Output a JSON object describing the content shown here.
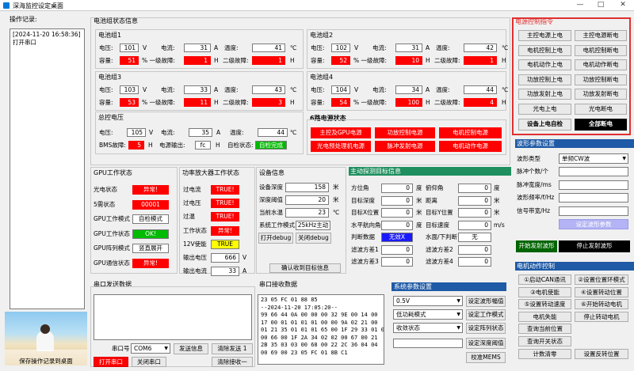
{
  "window": {
    "title": "深海监控设定桌面",
    "min": "—",
    "max": "□",
    "close": "✕"
  },
  "log": {
    "title": "操作记录:",
    "lines": "[2024-11-20 16:58:36]\n打开串口",
    "save": "保存操作记录到桌面"
  },
  "battery": {
    "title": "电池组状态信息",
    "groups": [
      {
        "name": "电池组1",
        "v": "101",
        "i": "31",
        "t": "41",
        "cap": "51",
        "f1": "1",
        "f2": "1"
      },
      {
        "name": "电池组2",
        "v": "102",
        "i": "31",
        "t": "42",
        "cap": "52",
        "f1": "10",
        "f2": "1"
      },
      {
        "name": "电池组3",
        "v": "103",
        "i": "33",
        "t": "43",
        "cap": "53",
        "f1": "11",
        "f2": "3"
      },
      {
        "name": "电池组4",
        "v": "104",
        "i": "34",
        "t": "44",
        "cap": "54",
        "f1": "100",
        "f2": "4"
      }
    ],
    "lbl": {
      "v": "电压:",
      "i": "电流:",
      "t": "温度:",
      "cap": "容量:",
      "f1": "%  一级故障:",
      "f2": "二级故障:",
      "uv": "V",
      "ui": "A",
      "ut": "℃",
      "uf": "H"
    },
    "total": {
      "name": "总控电压",
      "v": "105",
      "i": "35",
      "t": "44",
      "bms_label": "BMS故障:",
      "bms": "5",
      "bms_unit": "H",
      "out_label": "电源输出:",
      "out": "fc",
      "out_unit": "H",
      "self_label": "自检状态:",
      "self": "自检完成"
    }
  },
  "power6": {
    "title": "6路电源状态",
    "items": [
      "主控及GPU电源",
      "功放控制电源",
      "电机控制电源",
      "光电预处理机电源",
      "脉冲发射电源",
      "电机动作电源"
    ]
  },
  "ctrl": {
    "title": "电源控制指令",
    "buttons": [
      "主控电源上电",
      "主控电源断电",
      "电机控制上电",
      "电机控制断电",
      "电机动作上电",
      "电机动作断电",
      "功放控制上电",
      "功放控制断电",
      "功放发射上电",
      "功放发射断电",
      "光电上电",
      "光电断电"
    ],
    "selfcheck": "设备上电自检",
    "alloff": "全部断电"
  },
  "wave": {
    "title": "波形参数设置",
    "type_label": "波形类型",
    "type": "单频CW波",
    "fields": [
      "脉冲个数/个",
      "脉冲宽度/ms",
      "波形频率/f/Hz",
      "信号带宽/Hz"
    ],
    "set": "设定波形参数",
    "start": "开始发射波形",
    "stop": "停止发射波形"
  },
  "gpu": {
    "title": "GPU工作状态",
    "rows": [
      {
        "l": "光电状态",
        "v": "异常!"
      },
      {
        "l": "5需状态",
        "v": "00001"
      },
      {
        "l": "GPU工作模式",
        "v": "自检模式"
      },
      {
        "l": "GPU工作状态",
        "v": "OK!"
      },
      {
        "l": "GPU阵列模式",
        "v": "竖直展开"
      },
      {
        "l": "GPU通信状态",
        "v": "异常!"
      }
    ]
  },
  "amp": {
    "title": "功率放大器工作状态",
    "rows": [
      {
        "l": "过电流",
        "v": "TRUE!"
      },
      {
        "l": "过电压",
        "v": "TRUE!"
      },
      {
        "l": "过温",
        "v": "TRUE!"
      },
      {
        "l": "工作状态",
        "v": "异常!"
      },
      {
        "l": "12V使能",
        "v": "TRUE"
      },
      {
        "l": "输出电压",
        "v": "666",
        "u": "V"
      },
      {
        "l": "输出电流",
        "v": "33",
        "u": "A"
      }
    ]
  },
  "dev": {
    "title": "设备信息",
    "rows": [
      {
        "l": "设备深度",
        "v": "158",
        "u": "米"
      },
      {
        "l": "深度阈值",
        "v": "20",
        "u": "米"
      },
      {
        "l": "当前水温",
        "v": "23",
        "u": "℃"
      },
      {
        "l": "系统工作模式",
        "v": "25kHz主动",
        "u": ""
      }
    ],
    "dbg_on": "打开debug",
    "dbg_off": "关闭debug"
  },
  "sonar": {
    "title": "主动探测目标信息",
    "left": [
      {
        "l": "方位角",
        "v": "0",
        "u": "度"
      },
      {
        "l": "目标深度",
        "v": "0",
        "u": "米"
      },
      {
        "l": "目标X位置",
        "v": "0",
        "u": "米"
      },
      {
        "l": "水平航向角",
        "v": "0",
        "u": "度"
      },
      {
        "l": "判断数据",
        "v": "无效X",
        "u": ""
      },
      {
        "l": "滤波方差1",
        "v": "0",
        "u": ""
      },
      {
        "l": "滤波方差3",
        "v": "0",
        "u": ""
      }
    ],
    "right": [
      {
        "l": "俯仰角",
        "v": "0",
        "u": "度"
      },
      {
        "l": "距离",
        "v": "0",
        "u": "米"
      },
      {
        "l": "目标Y位置",
        "v": "0",
        "u": "米"
      },
      {
        "l": "目标速度",
        "v": "0",
        "u": "m/s"
      },
      {
        "l": "水面/下判断",
        "v": "无",
        "u": ""
      },
      {
        "l": "滤波方差2",
        "v": "0",
        "u": ""
      },
      {
        "l": "滤波方差4",
        "v": "0",
        "u": ""
      }
    ],
    "confirm": "确认收到目标信息"
  },
  "serial": {
    "send_title": "串口发送数据",
    "port_label": "串口号",
    "port": "COM6",
    "send": "发送信息",
    "clear_send": "清除发送 1",
    "open": "打开串口",
    "close": "关闭串口",
    "clear_recv": "清除接收一"
  },
  "recv": {
    "title": "串口接收数据",
    "text": "23 05 FC 01 88 85\n--2024-11-20 17:05:20--\n99 66 44 0A 00 00 00 32 9E 00 14 00\n17 00 01 01 01 01 00 00 9A 02 21 00\n01 21 35 01 01 01 65 00 1F 29 33 01 01\n00 66 00 1F 2A 34 02 02 00 67 00 21\n2B 35 03 03 00 68 00 22 2C 36 04 04\n00 69 00 23 05 FC 01 8B C1"
  },
  "sys": {
    "title": "系统参数设置",
    "sel": [
      "0.5V",
      "低功耗模式",
      "收敛状态"
    ],
    "buttons": [
      "设定波形幅值",
      "设定工作模式",
      "设定阵列状态",
      "设定深度阈值",
      "校准MEMS"
    ]
  },
  "motor": {
    "title": "电机动作控制",
    "buttons": [
      "①启动CAN通讯",
      "②设置位置环模式",
      "③电机使能",
      "④设置转动位置",
      "⑤设置转动速度",
      "⑥开始转动电机",
      "电机失能",
      "停止转动电机",
      "查询当前位置",
      "",
      "查询开关状态",
      "",
      "计数清零",
      "设置反转位置"
    ]
  }
}
